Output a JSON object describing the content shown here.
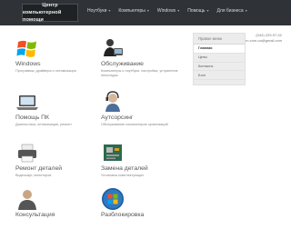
{
  "header": {
    "brand_line1": "Центр",
    "brand_line2": "компьютерной помощи",
    "nav": [
      {
        "label": "Ноутбуки"
      },
      {
        "label": "Компьютеры"
      },
      {
        "label": "Windows"
      },
      {
        "label": "Помощь"
      },
      {
        "label": "Для бизнеса"
      }
    ]
  },
  "contacts": {
    "phone": "(044) 229-97-42",
    "email": "websalon.com.ua@gmail.com"
  },
  "tiles": [
    {
      "title": "Windows",
      "desc": "Программы, драйвера и оптимизация",
      "icon": "windows-logo-icon"
    },
    {
      "title": "Обслуживание",
      "desc": "Компьютеры и ноутбуки, настройка, устранение неполадок",
      "icon": "technician-icon"
    },
    {
      "title": "Помощь ПК",
      "desc": "Диагностика, оптимизация, ремонт",
      "icon": "laptop-icon"
    },
    {
      "title": "Аутсорсинг",
      "desc": "Обслуживание компьютеров организаций",
      "icon": "headset-operator-icon"
    },
    {
      "title": "Ремонт деталей",
      "desc": "Видеокарт, мониторов",
      "icon": "printer-icon"
    },
    {
      "title": "Замена деталей",
      "desc": "Установка комплектующих",
      "icon": "circuit-board-icon"
    },
    {
      "title": "Консультация",
      "desc": "",
      "icon": "person-icon"
    },
    {
      "title": "Разблокировка",
      "desc": "",
      "icon": "windows-orb-icon"
    }
  ],
  "sidebar": {
    "title": "Правое меню",
    "items": [
      {
        "label": "Главная"
      },
      {
        "label": "Цены"
      },
      {
        "label": "Контакты"
      },
      {
        "label": "Блог"
      }
    ]
  },
  "colors": {
    "topbar": "#2f3337",
    "sidebar_bg": "#ececec",
    "accent_orange": "#f25022",
    "accent_green": "#7fba00",
    "accent_blue": "#00a4ef",
    "accent_yellow": "#ffb900"
  }
}
